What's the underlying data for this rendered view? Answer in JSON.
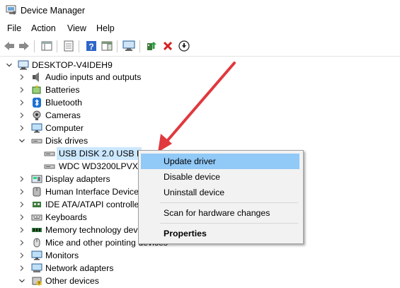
{
  "window": {
    "title": "Device Manager"
  },
  "menu": [
    "File",
    "Action",
    "View",
    "Help"
  ],
  "tree": {
    "root": "DESKTOP-V4IDEH9",
    "categories": [
      {
        "label": "Audio inputs and outputs",
        "icon": "speaker-icon"
      },
      {
        "label": "Batteries",
        "icon": "battery-icon"
      },
      {
        "label": "Bluetooth",
        "icon": "bluetooth-icon"
      },
      {
        "label": "Cameras",
        "icon": "camera-icon"
      },
      {
        "label": "Computer",
        "icon": "monitor-icon"
      },
      {
        "label": "Disk drives",
        "icon": "disk-drive-icon"
      },
      {
        "label": "USB DISK 2.0 USB Dev",
        "icon": "disk-drive-icon"
      },
      {
        "label": "WDC WD3200LPVX-60",
        "icon": "disk-drive-icon"
      },
      {
        "label": "Display adapters",
        "icon": "display-adapter-icon"
      },
      {
        "label": "Human Interface Devices",
        "icon": "hid-icon"
      },
      {
        "label": "IDE ATA/ATAPI controllers",
        "icon": "ide-controller-icon"
      },
      {
        "label": "Keyboards",
        "icon": "keyboard-icon"
      },
      {
        "label": "Memory technology dev",
        "icon": "memory-icon"
      },
      {
        "label": "Mice and other pointing devices",
        "icon": "mouse-icon"
      },
      {
        "label": "Monitors",
        "icon": "monitor-icon"
      },
      {
        "label": "Network adapters",
        "icon": "network-adapter-icon"
      },
      {
        "label": "Other devices",
        "icon": "other-devices-icon"
      }
    ]
  },
  "context_menu": {
    "items": [
      "Update driver",
      "Disable device",
      "Uninstall device",
      "Scan for hardware changes",
      "Properties"
    ],
    "highlighted": "Update driver"
  },
  "colors": {
    "selection": "#cce8ff",
    "menu_highlight": "#91c9f7",
    "arrow": "#e0393e"
  }
}
